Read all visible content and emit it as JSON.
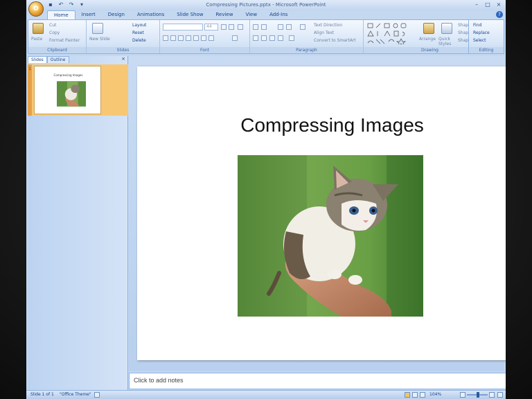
{
  "window": {
    "title": "Compressing Pictures.pptx - Microsoft PowerPoint",
    "office_button": "O"
  },
  "quick_access": [
    "save",
    "undo",
    "redo",
    "customize"
  ],
  "tabs": [
    {
      "label": "Home",
      "active": true
    },
    {
      "label": "Insert",
      "active": false
    },
    {
      "label": "Design",
      "active": false
    },
    {
      "label": "Animations",
      "active": false
    },
    {
      "label": "Slide Show",
      "active": false
    },
    {
      "label": "Review",
      "active": false
    },
    {
      "label": "View",
      "active": false
    },
    {
      "label": "Add-Ins",
      "active": false
    }
  ],
  "ribbon": {
    "clipboard": {
      "label": "Clipboard",
      "paste": "Paste",
      "cut": "Cut",
      "copy": "Copy",
      "format_painter": "Format Painter"
    },
    "slides": {
      "label": "Slides",
      "new_slide": "New Slide",
      "layout": "Layout",
      "reset": "Reset",
      "delete": "Delete"
    },
    "font": {
      "label": "Font",
      "font_size": "44"
    },
    "paragraph": {
      "label": "Paragraph",
      "text_direction": "Text Direction",
      "align_text": "Align Text",
      "convert_smartart": "Convert to SmartArt"
    },
    "drawing": {
      "label": "Drawing",
      "arrange": "Arrange",
      "quick_styles": "Quick Styles",
      "shape_fill": "Shape Fill",
      "shape_outline": "Shape Outline",
      "shape_effects": "Shape Effects"
    },
    "editing": {
      "label": "Editing",
      "find": "Find",
      "replace": "Replace",
      "select": "Select"
    }
  },
  "slides_pane": {
    "tab_slides": "Slides",
    "tab_outline": "Outline",
    "close": "×",
    "thumb_number": "1",
    "thumb_title": "Compressing Images"
  },
  "slide": {
    "title": "Compressing Images"
  },
  "notes": {
    "placeholder": "Click to add notes"
  },
  "status": {
    "slide_info": "Slide 1 of 1",
    "theme": "\"Office Theme\"",
    "zoom": "104%"
  }
}
